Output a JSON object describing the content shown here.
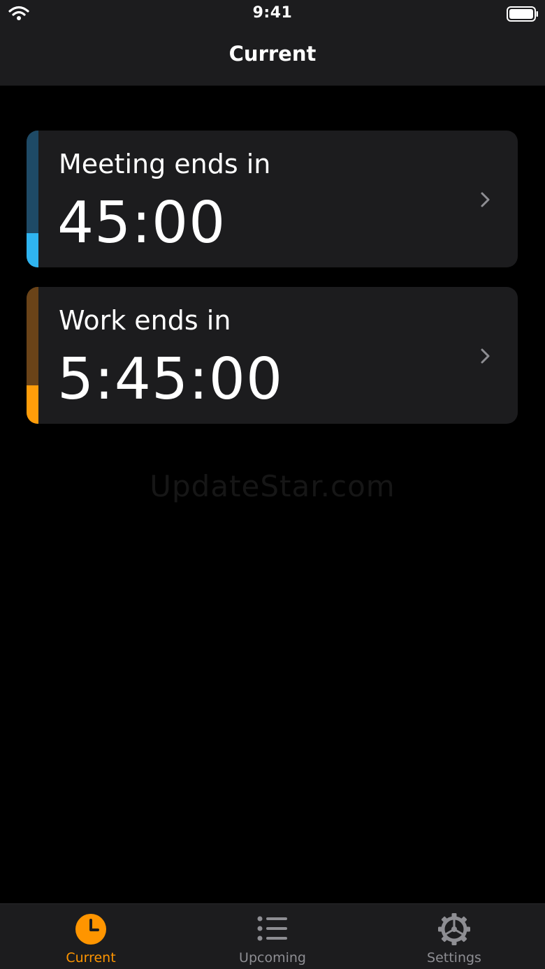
{
  "status_bar": {
    "time": "9:41"
  },
  "nav": {
    "title": "Current"
  },
  "timers": [
    {
      "label": "Meeting ends in",
      "value": "45:00",
      "color": "#2fb4f0",
      "dim_color": "#1e4a66",
      "progress": 0.25
    },
    {
      "label": "Work ends in",
      "value": "5:45:00",
      "color": "#ff9d0a",
      "dim_color": "#6a4318",
      "progress": 0.28
    }
  ],
  "watermark": "UpdateStar.com",
  "tabs": [
    {
      "label": "Current",
      "icon": "clock-icon",
      "active": true
    },
    {
      "label": "Upcoming",
      "icon": "list-icon",
      "active": false
    },
    {
      "label": "Settings",
      "icon": "gear-icon",
      "active": false
    }
  ],
  "colors": {
    "accent": "#ff9500",
    "inactive": "#8e8e93",
    "card_bg": "#1c1c1e"
  }
}
